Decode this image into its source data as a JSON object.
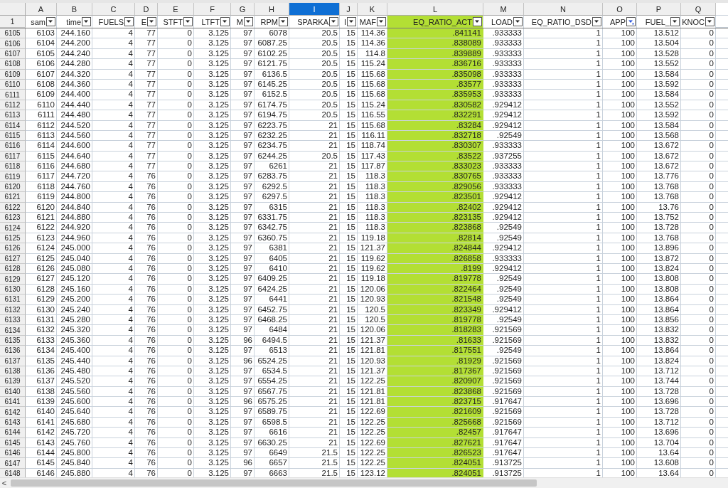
{
  "corner_row_label": "1",
  "columns": [
    {
      "letter": "A",
      "label": "sam",
      "selected": false,
      "highlighted": false,
      "filter_active": false
    },
    {
      "letter": "B",
      "label": "time",
      "selected": false,
      "highlighted": false,
      "filter_active": false
    },
    {
      "letter": "C",
      "label": "FUELS",
      "selected": false,
      "highlighted": false,
      "filter_active": false
    },
    {
      "letter": "D",
      "label": "E",
      "selected": false,
      "highlighted": false,
      "filter_active": false
    },
    {
      "letter": "E",
      "label": "STFT",
      "selected": false,
      "highlighted": false,
      "filter_active": false
    },
    {
      "letter": "F",
      "label": "LTFT",
      "selected": false,
      "highlighted": false,
      "filter_active": false
    },
    {
      "letter": "G",
      "label": "M",
      "selected": false,
      "highlighted": false,
      "filter_active": false
    },
    {
      "letter": "H",
      "label": "RPM",
      "selected": false,
      "highlighted": false,
      "filter_active": false
    },
    {
      "letter": "I",
      "label": "SPARKA",
      "selected": true,
      "highlighted": false,
      "filter_active": false
    },
    {
      "letter": "J",
      "label": "I",
      "selected": false,
      "highlighted": false,
      "filter_active": false
    },
    {
      "letter": "K",
      "label": "MAF",
      "selected": false,
      "highlighted": false,
      "filter_active": false
    },
    {
      "letter": "L",
      "label": "EQ_RATIO_ACT",
      "selected": false,
      "highlighted": true,
      "filter_active": false
    },
    {
      "letter": "M",
      "label": "LOAD",
      "selected": false,
      "highlighted": false,
      "filter_active": false
    },
    {
      "letter": "N",
      "label": "EQ_RATIO_DSD",
      "selected": false,
      "highlighted": false,
      "filter_active": false
    },
    {
      "letter": "O",
      "label": "APP",
      "selected": false,
      "highlighted": false,
      "filter_active": true
    },
    {
      "letter": "P",
      "label": "FUEL_",
      "selected": false,
      "highlighted": false,
      "filter_active": false
    },
    {
      "letter": "Q",
      "label": "KNOC",
      "selected": false,
      "highlighted": false,
      "filter_active": false
    }
  ],
  "rows": [
    {
      "row": "6105",
      "cells": [
        "6103",
        "244.160",
        "4",
        "77",
        "0",
        "3.125",
        "97",
        "6078",
        "20.5",
        "15",
        "114.36",
        ".841141",
        ".933333",
        "1",
        "100",
        "13.512",
        "0"
      ]
    },
    {
      "row": "6106",
      "cells": [
        "6104",
        "244.200",
        "4",
        "77",
        "0",
        "3.125",
        "97",
        "6087.25",
        "20.5",
        "15",
        "114.36",
        ".838089",
        ".933333",
        "1",
        "100",
        "13.504",
        "0"
      ]
    },
    {
      "row": "6107",
      "cells": [
        "6105",
        "244.240",
        "4",
        "77",
        "0",
        "3.125",
        "97",
        "6102.25",
        "20.5",
        "15",
        "114.8",
        ".839889",
        ".933333",
        "1",
        "100",
        "13.528",
        "0"
      ]
    },
    {
      "row": "6108",
      "cells": [
        "6106",
        "244.280",
        "4",
        "77",
        "0",
        "3.125",
        "97",
        "6121.75",
        "20.5",
        "15",
        "115.24",
        ".836716",
        ".933333",
        "1",
        "100",
        "13.552",
        "0"
      ]
    },
    {
      "row": "6109",
      "cells": [
        "6107",
        "244.320",
        "4",
        "77",
        "0",
        "3.125",
        "97",
        "6136.5",
        "20.5",
        "15",
        "115.68",
        ".835098",
        ".933333",
        "1",
        "100",
        "13.584",
        "0"
      ]
    },
    {
      "row": "6110",
      "cells": [
        "6108",
        "244.360",
        "4",
        "77",
        "0",
        "3.125",
        "97",
        "6145.25",
        "20.5",
        "15",
        "115.68",
        ".83577",
        ".933333",
        "1",
        "100",
        "13.592",
        "0"
      ]
    },
    {
      "row": "6111",
      "cells": [
        "6109",
        "244.400",
        "4",
        "77",
        "0",
        "3.125",
        "97",
        "6152.5",
        "20.5",
        "15",
        "115.68",
        ".835953",
        ".933333",
        "1",
        "100",
        "13.584",
        "0"
      ]
    },
    {
      "row": "6112",
      "cells": [
        "6110",
        "244.440",
        "4",
        "77",
        "0",
        "3.125",
        "97",
        "6174.75",
        "20.5",
        "15",
        "115.24",
        ".830582",
        ".929412",
        "1",
        "100",
        "13.552",
        "0"
      ]
    },
    {
      "row": "6113",
      "cells": [
        "6111",
        "244.480",
        "4",
        "77",
        "0",
        "3.125",
        "97",
        "6194.75",
        "20.5",
        "15",
        "116.55",
        ".832291",
        ".929412",
        "1",
        "100",
        "13.592",
        "0"
      ]
    },
    {
      "row": "6114",
      "cells": [
        "6112",
        "244.520",
        "4",
        "77",
        "0",
        "3.125",
        "97",
        "6223.75",
        "21",
        "15",
        "115.68",
        ".83284",
        ".929412",
        "1",
        "100",
        "13.584",
        "0"
      ]
    },
    {
      "row": "6115",
      "cells": [
        "6113",
        "244.560",
        "4",
        "77",
        "0",
        "3.125",
        "97",
        "6232.25",
        "21",
        "15",
        "116.11",
        ".832718",
        ".92549",
        "1",
        "100",
        "13.568",
        "0"
      ]
    },
    {
      "row": "6116",
      "cells": [
        "6114",
        "244.600",
        "4",
        "77",
        "0",
        "3.125",
        "97",
        "6234.75",
        "21",
        "15",
        "118.74",
        ".830307",
        ".933333",
        "1",
        "100",
        "13.672",
        "0"
      ]
    },
    {
      "row": "6117",
      "cells": [
        "6115",
        "244.640",
        "4",
        "77",
        "0",
        "3.125",
        "97",
        "6244.25",
        "20.5",
        "15",
        "117.43",
        ".83522",
        ".937255",
        "1",
        "100",
        "13.672",
        "0"
      ]
    },
    {
      "row": "6118",
      "cells": [
        "6116",
        "244.680",
        "4",
        "77",
        "0",
        "3.125",
        "97",
        "6261",
        "21",
        "15",
        "117.87",
        ".833023",
        ".933333",
        "1",
        "100",
        "13.672",
        "0"
      ]
    },
    {
      "row": "6119",
      "cells": [
        "6117",
        "244.720",
        "4",
        "76",
        "0",
        "3.125",
        "97",
        "6283.75",
        "21",
        "15",
        "118.3",
        ".830765",
        ".933333",
        "1",
        "100",
        "13.776",
        "0"
      ]
    },
    {
      "row": "6120",
      "cells": [
        "6118",
        "244.760",
        "4",
        "76",
        "0",
        "3.125",
        "97",
        "6292.5",
        "21",
        "15",
        "118.3",
        ".829056",
        ".933333",
        "1",
        "100",
        "13.768",
        "0"
      ]
    },
    {
      "row": "6121",
      "cells": [
        "6119",
        "244.800",
        "4",
        "76",
        "0",
        "3.125",
        "97",
        "6297.5",
        "21",
        "15",
        "118.3",
        ".823501",
        ".929412",
        "1",
        "100",
        "13.768",
        "0"
      ]
    },
    {
      "row": "6122",
      "cells": [
        "6120",
        "244.840",
        "4",
        "76",
        "0",
        "3.125",
        "97",
        "6315",
        "21",
        "15",
        "118.3",
        ".82402",
        ".929412",
        "1",
        "100",
        "13.76",
        "0"
      ]
    },
    {
      "row": "6123",
      "cells": [
        "6121",
        "244.880",
        "4",
        "76",
        "0",
        "3.125",
        "97",
        "6331.75",
        "21",
        "15",
        "118.3",
        ".823135",
        ".929412",
        "1",
        "100",
        "13.752",
        "0"
      ]
    },
    {
      "row": "6124",
      "cells": [
        "6122",
        "244.920",
        "4",
        "76",
        "0",
        "3.125",
        "97",
        "6342.75",
        "21",
        "15",
        "118.3",
        ".823868",
        ".92549",
        "1",
        "100",
        "13.728",
        "0"
      ]
    },
    {
      "row": "6125",
      "cells": [
        "6123",
        "244.960",
        "4",
        "76",
        "0",
        "3.125",
        "97",
        "6360.75",
        "21",
        "15",
        "119.18",
        ".82814",
        ".92549",
        "1",
        "100",
        "13.768",
        "0"
      ]
    },
    {
      "row": "6126",
      "cells": [
        "6124",
        "245.000",
        "4",
        "76",
        "0",
        "3.125",
        "97",
        "6381",
        "21",
        "15",
        "121.37",
        ".824844",
        ".929412",
        "1",
        "100",
        "13.896",
        "0"
      ]
    },
    {
      "row": "6127",
      "cells": [
        "6125",
        "245.040",
        "4",
        "76",
        "0",
        "3.125",
        "97",
        "6405",
        "21",
        "15",
        "119.62",
        ".826858",
        ".933333",
        "1",
        "100",
        "13.872",
        "0"
      ]
    },
    {
      "row": "6128",
      "cells": [
        "6126",
        "245.080",
        "4",
        "76",
        "0",
        "3.125",
        "97",
        "6410",
        "21",
        "15",
        "119.62",
        ".8199",
        ".929412",
        "1",
        "100",
        "13.824",
        "0"
      ]
    },
    {
      "row": "6129",
      "cells": [
        "6127",
        "245.120",
        "4",
        "76",
        "0",
        "3.125",
        "97",
        "6409.25",
        "21",
        "15",
        "119.18",
        ".819778",
        ".92549",
        "1",
        "100",
        "13.808",
        "0"
      ]
    },
    {
      "row": "6130",
      "cells": [
        "6128",
        "245.160",
        "4",
        "76",
        "0",
        "3.125",
        "97",
        "6424.25",
        "21",
        "15",
        "120.06",
        ".822464",
        ".92549",
        "1",
        "100",
        "13.808",
        "0"
      ]
    },
    {
      "row": "6131",
      "cells": [
        "6129",
        "245.200",
        "4",
        "76",
        "0",
        "3.125",
        "97",
        "6441",
        "21",
        "15",
        "120.93",
        ".821548",
        ".92549",
        "1",
        "100",
        "13.864",
        "0"
      ]
    },
    {
      "row": "6132",
      "cells": [
        "6130",
        "245.240",
        "4",
        "76",
        "0",
        "3.125",
        "97",
        "6452.75",
        "21",
        "15",
        "120.5",
        ".823349",
        ".929412",
        "1",
        "100",
        "13.864",
        "0"
      ]
    },
    {
      "row": "6133",
      "cells": [
        "6131",
        "245.280",
        "4",
        "76",
        "0",
        "3.125",
        "97",
        "6468.25",
        "21",
        "15",
        "120.5",
        ".819778",
        ".92549",
        "1",
        "100",
        "13.856",
        "0"
      ]
    },
    {
      "row": "6134",
      "cells": [
        "6132",
        "245.320",
        "4",
        "76",
        "0",
        "3.125",
        "97",
        "6484",
        "21",
        "15",
        "120.06",
        ".818283",
        ".921569",
        "1",
        "100",
        "13.832",
        "0"
      ]
    },
    {
      "row": "6135",
      "cells": [
        "6133",
        "245.360",
        "4",
        "76",
        "0",
        "3.125",
        "96",
        "6494.5",
        "21",
        "15",
        "121.37",
        ".81633",
        ".921569",
        "1",
        "100",
        "13.832",
        "0"
      ]
    },
    {
      "row": "6136",
      "cells": [
        "6134",
        "245.400",
        "4",
        "76",
        "0",
        "3.125",
        "97",
        "6513",
        "21",
        "15",
        "121.81",
        ".817551",
        ".92549",
        "1",
        "100",
        "13.864",
        "0"
      ]
    },
    {
      "row": "6137",
      "cells": [
        "6135",
        "245.440",
        "4",
        "76",
        "0",
        "3.125",
        "96",
        "6524.25",
        "21",
        "15",
        "120.93",
        ".81929",
        ".921569",
        "1",
        "100",
        "13.824",
        "0"
      ]
    },
    {
      "row": "6138",
      "cells": [
        "6136",
        "245.480",
        "4",
        "76",
        "0",
        "3.125",
        "97",
        "6534.5",
        "21",
        "15",
        "121.37",
        ".817367",
        ".921569",
        "1",
        "100",
        "13.712",
        "0"
      ]
    },
    {
      "row": "6139",
      "cells": [
        "6137",
        "245.520",
        "4",
        "76",
        "0",
        "3.125",
        "97",
        "6554.25",
        "21",
        "15",
        "122.25",
        ".820907",
        ".921569",
        "1",
        "100",
        "13.744",
        "0"
      ]
    },
    {
      "row": "6140",
      "cells": [
        "6138",
        "245.560",
        "4",
        "76",
        "0",
        "3.125",
        "97",
        "6567.75",
        "21",
        "15",
        "121.81",
        ".823868",
        ".921569",
        "1",
        "100",
        "13.728",
        "0"
      ]
    },
    {
      "row": "6141",
      "cells": [
        "6139",
        "245.600",
        "4",
        "76",
        "0",
        "3.125",
        "96",
        "6575.25",
        "21",
        "15",
        "121.81",
        ".823715",
        ".917647",
        "1",
        "100",
        "13.696",
        "0"
      ]
    },
    {
      "row": "6142",
      "cells": [
        "6140",
        "245.640",
        "4",
        "76",
        "0",
        "3.125",
        "97",
        "6589.75",
        "21",
        "15",
        "122.69",
        ".821609",
        ".921569",
        "1",
        "100",
        "13.728",
        "0"
      ]
    },
    {
      "row": "6143",
      "cells": [
        "6141",
        "245.680",
        "4",
        "76",
        "0",
        "3.125",
        "97",
        "6598.5",
        "21",
        "15",
        "122.25",
        ".825668",
        ".921569",
        "1",
        "100",
        "13.712",
        "0"
      ]
    },
    {
      "row": "6144",
      "cells": [
        "6142",
        "245.720",
        "4",
        "76",
        "0",
        "3.125",
        "97",
        "6616",
        "21",
        "15",
        "122.25",
        ".82457",
        ".917647",
        "1",
        "100",
        "13.696",
        "0"
      ]
    },
    {
      "row": "6145",
      "cells": [
        "6143",
        "245.760",
        "4",
        "76",
        "0",
        "3.125",
        "97",
        "6630.25",
        "21",
        "15",
        "122.69",
        ".827621",
        ".917647",
        "1",
        "100",
        "13.704",
        "0"
      ]
    },
    {
      "row": "6146",
      "cells": [
        "6144",
        "245.800",
        "4",
        "76",
        "0",
        "3.125",
        "97",
        "6649",
        "21.5",
        "15",
        "122.25",
        ".826523",
        ".917647",
        "1",
        "100",
        "13.64",
        "0"
      ]
    },
    {
      "row": "6147",
      "cells": [
        "6145",
        "245.840",
        "4",
        "76",
        "0",
        "3.125",
        "96",
        "6657",
        "21.5",
        "15",
        "122.25",
        ".824051",
        ".913725",
        "1",
        "100",
        "13.608",
        "0"
      ]
    },
    {
      "row": "6148",
      "cells": [
        "6146",
        "245.880",
        "4",
        "76",
        "0",
        "3.125",
        "97",
        "6663",
        "21.5",
        "15",
        "123.12",
        ".824051",
        ".913725",
        "1",
        "100",
        "13.64",
        "0"
      ]
    }
  ],
  "scrollbar": {
    "left_arrow": "<"
  }
}
